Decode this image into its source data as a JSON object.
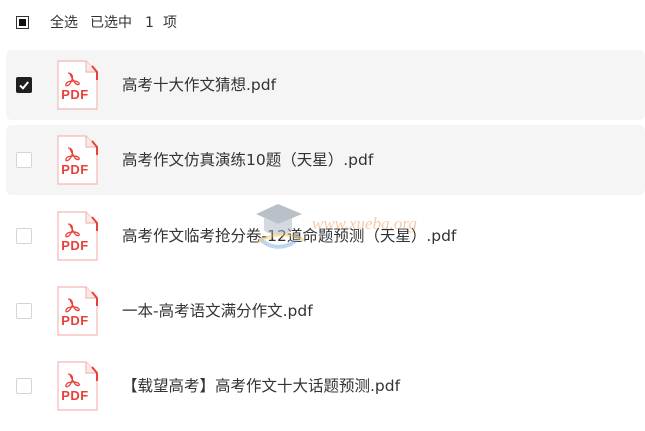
{
  "toolbar": {
    "select_all_label": "全选",
    "selected_prefix": "已选中",
    "selected_count": "1",
    "selected_suffix": "项"
  },
  "files": [
    {
      "name": "高考十大作文猜想.pdf",
      "type_label": "PDF",
      "checked": true
    },
    {
      "name": "高考作文仿真演练10题（天星）.pdf",
      "type_label": "PDF",
      "checked": false
    },
    {
      "name": "高考作文临考抢分卷-12道命题预测（天星）.pdf",
      "type_label": "PDF",
      "checked": false
    },
    {
      "name": "一本-高考语文满分作文.pdf",
      "type_label": "PDF",
      "checked": false
    },
    {
      "name": "【载望高考】高考作文十大话题预测.pdf",
      "type_label": "PDF",
      "checked": false
    }
  ],
  "watermark": {
    "text": "www.xueba.org"
  },
  "colors": {
    "pdf_red": "#e8413a",
    "row_highlight": "#f5f5f5",
    "checkbox_checked": "#1f1f1f"
  },
  "icons": {
    "file": "pdf-file-icon",
    "check": "checkmark-icon"
  }
}
